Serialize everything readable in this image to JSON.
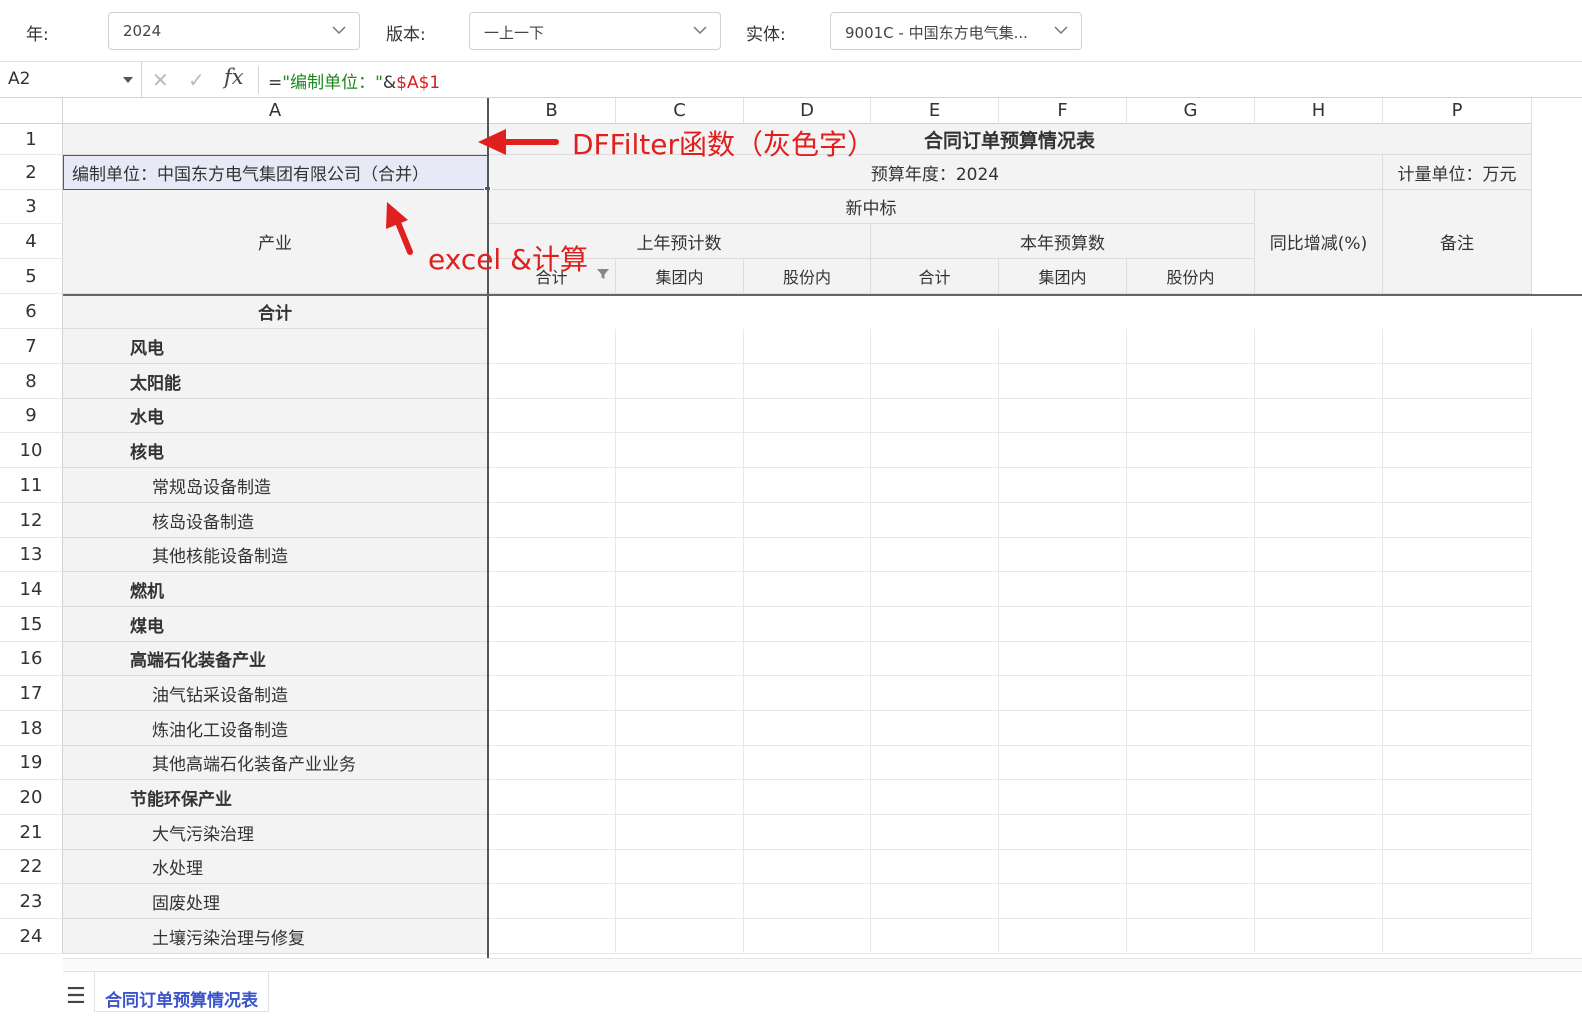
{
  "filters": {
    "year_label": "年:",
    "year_value": "2024",
    "version_label": "版本:",
    "version_value": "一上一下",
    "entity_label": "实体:",
    "entity_value": "9001C - 中国东方电气集..."
  },
  "formula_bar": {
    "cell_ref": "A2",
    "formula_eq": "=",
    "formula_str": "\"编制单位：\"",
    "formula_amp": "&",
    "formula_ref": "$A$1"
  },
  "columns": [
    "A",
    "B",
    "C",
    "D",
    "E",
    "F",
    "G",
    "H",
    "P"
  ],
  "rows": [
    "1",
    "2",
    "3",
    "4",
    "5",
    "6",
    "7",
    "8",
    "9",
    "10",
    "11",
    "12",
    "13",
    "14",
    "15",
    "16",
    "17",
    "18",
    "19",
    "20",
    "21",
    "22",
    "23",
    "24"
  ],
  "report": {
    "title": "合同订单预算情况表",
    "unit_org": "编制单位：中国东方电气集团有限公司（合并）",
    "budget_year": "预算年度：2024",
    "measure_unit": "计量单位：万元",
    "header_industry": "产业",
    "header_new_bid": "新中标",
    "header_last_year": "上年预计数",
    "header_this_year": "本年预算数",
    "header_yoy": "同比增减(%)",
    "header_note": "备注",
    "sub_total": "合计",
    "sub_group": "集团内",
    "sub_share": "股份内"
  },
  "industries": [
    {
      "label": "合计",
      "level": 0
    },
    {
      "label": "风电",
      "level": 1
    },
    {
      "label": "太阳能",
      "level": 1
    },
    {
      "label": "水电",
      "level": 1
    },
    {
      "label": "核电",
      "level": 1
    },
    {
      "label": "常规岛设备制造",
      "level": 2
    },
    {
      "label": "核岛设备制造",
      "level": 2
    },
    {
      "label": "其他核能设备制造",
      "level": 2
    },
    {
      "label": "燃机",
      "level": 1
    },
    {
      "label": "煤电",
      "level": 1
    },
    {
      "label": "高端石化装备产业",
      "level": 1
    },
    {
      "label": "油气钻采设备制造",
      "level": 2
    },
    {
      "label": "炼油化工设备制造",
      "level": 2
    },
    {
      "label": "其他高端石化装备产业业务",
      "level": 2
    },
    {
      "label": "节能环保产业",
      "level": 1
    },
    {
      "label": "大气污染治理",
      "level": 2
    },
    {
      "label": "水处理",
      "level": 2
    },
    {
      "label": "固废处理",
      "level": 2
    },
    {
      "label": "土壤污染治理与修复",
      "level": 2
    }
  ],
  "annotations": {
    "dffilter": "DFFilter函数（灰色字）",
    "excel": "excel &计算"
  },
  "sheet_tab": "合同订单预算情况表",
  "colors": {
    "accent": "#3b54c9",
    "annotation": "#e0201e",
    "cell_gray": "#f3f3f3"
  }
}
